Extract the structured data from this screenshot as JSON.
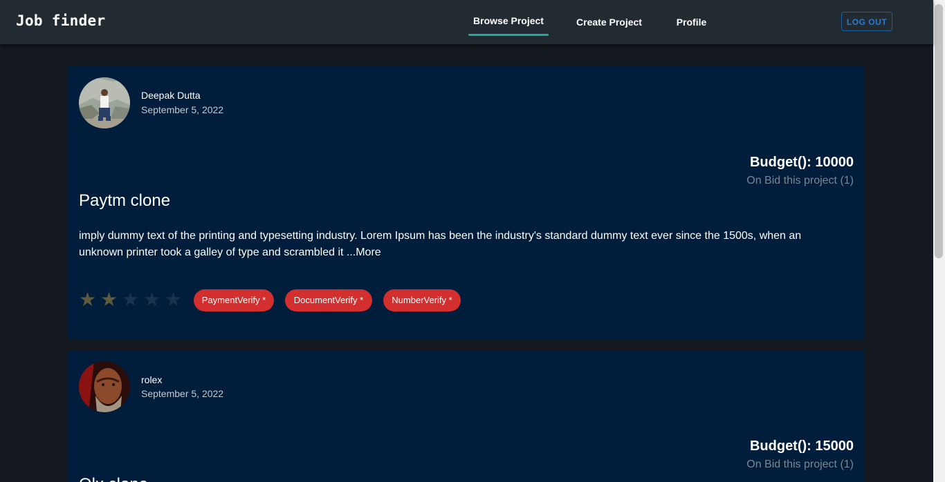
{
  "app": {
    "brand": "Job finder"
  },
  "nav": {
    "tabs": [
      {
        "label": "Browse Project",
        "active": true
      },
      {
        "label": "Create Project",
        "active": false
      },
      {
        "label": "Profile",
        "active": false
      }
    ],
    "logout_label": "LOG OUT"
  },
  "colors": {
    "tab_indicator": "#26a69a",
    "card_bg": "#001e3c",
    "chip_bg": "#d32f2f",
    "logout_text": "#2a7bd1"
  },
  "projects": [
    {
      "author": "Deepak Dutta",
      "date": "September 5, 2022",
      "budget": "Budget(): 10000",
      "bids": "On Bid this project (1)",
      "title": "Paytm clone",
      "description": "imply dummy text of the printing and typesetting industry. Lorem Ipsum has been the industry's standard dummy text ever since the 1500s, when an unknown printer took a galley of type and scrambled it ...More",
      "rating": 2,
      "rating_max": 5,
      "badges": [
        "PaymentVerify *",
        "DocumentVerify *",
        "NumberVerify *"
      ]
    },
    {
      "author": "rolex",
      "date": "September 5, 2022",
      "budget": "Budget(): 15000",
      "bids": "On Bid this project (1)",
      "title": "Olx clone"
    }
  ]
}
